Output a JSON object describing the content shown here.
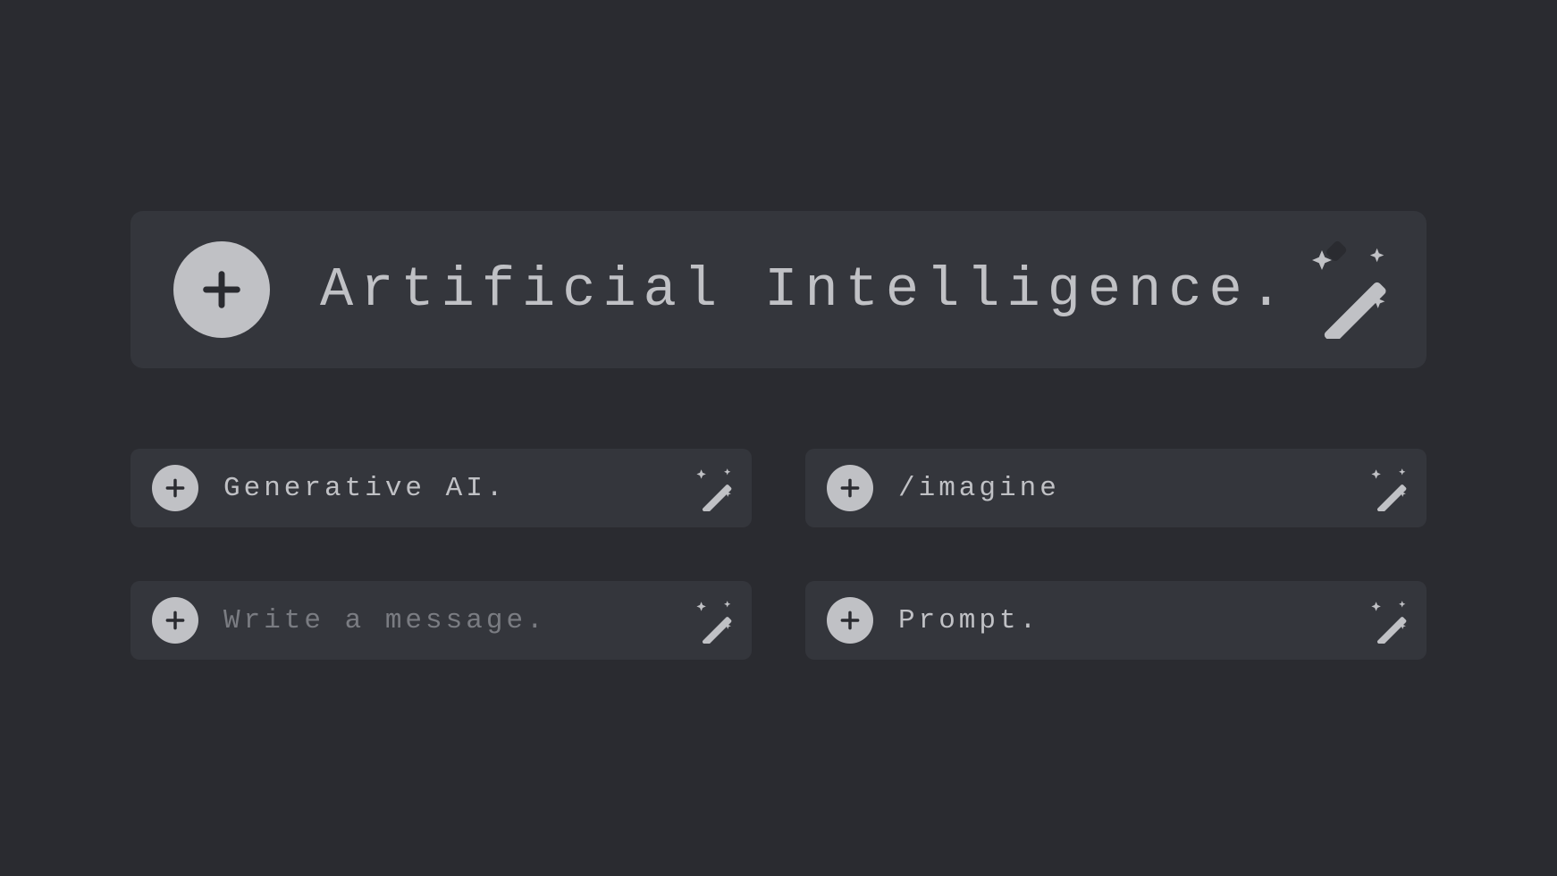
{
  "main": {
    "value": "Artificial Intelligence."
  },
  "inputs": [
    {
      "value": "Generative AI.",
      "placeholder": false
    },
    {
      "value": "/imagine",
      "placeholder": false
    },
    {
      "value": "Write a message.",
      "placeholder": true
    },
    {
      "value": "Prompt.",
      "placeholder": false
    }
  ]
}
